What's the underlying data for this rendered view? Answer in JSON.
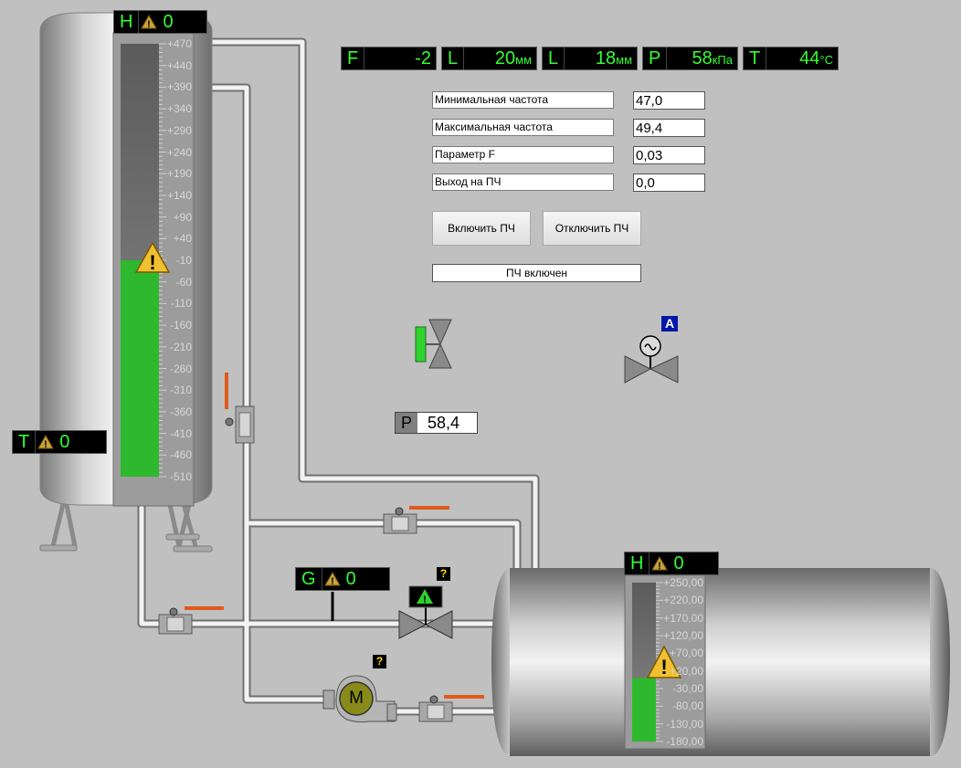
{
  "indicators": {
    "F": {
      "tag": "F",
      "value": "-2",
      "unit": ""
    },
    "L1": {
      "tag": "L",
      "value": "20",
      "unit": "мм"
    },
    "L2": {
      "tag": "L",
      "value": "18",
      "unit": "мм"
    },
    "P": {
      "tag": "P",
      "value": "58",
      "unit": "кПа"
    },
    "T": {
      "tag": "T",
      "value": "44",
      "unit": "°C"
    }
  },
  "vertical_tank": {
    "level_tag": "H",
    "level_value": "0",
    "temp_tag": "T",
    "temp_value": "0",
    "scale": [
      "+470",
      "+440",
      "+390",
      "+340",
      "+290",
      "+240",
      "+190",
      "+140",
      "+90",
      "+40",
      "-10",
      "-60",
      "-110",
      "-160",
      "-210",
      "-260",
      "-310",
      "-360",
      "-410",
      "-460",
      "-510"
    ],
    "fill_fraction": 0.5
  },
  "horizontal_tank": {
    "level_tag": "H",
    "level_value": "0",
    "scale": [
      "+250,00",
      "+220,00",
      "+170,00",
      "+120,00",
      "+70,00",
      "+20,00",
      "-30,00",
      "-80,00",
      "-130,00",
      "-180,00"
    ],
    "fill_fraction": 0.4
  },
  "flow": {
    "tag": "G",
    "value": "0"
  },
  "params": [
    {
      "label": "Минимальная частота",
      "value": "47,0"
    },
    {
      "label": "Максимальная частота",
      "value": "49,4"
    },
    {
      "label": "Параметр F",
      "value": "0,03"
    },
    {
      "label": "Выход на ПЧ",
      "value": "0,0"
    }
  ],
  "buttons": {
    "on": "Включить ПЧ",
    "off": "Отключить ПЧ"
  },
  "status": "ПЧ включен",
  "pressure": {
    "tag": "P",
    "value": "58,4"
  },
  "pump_label": "M",
  "auto_badge": "A",
  "unknown_badge": "?",
  "colors": {
    "background": "#c0c0c0",
    "indicator_text": "#33ff33",
    "level_fill": "#2db82d",
    "handle": "#e05a1a",
    "valve_green": "#2fd12f"
  }
}
